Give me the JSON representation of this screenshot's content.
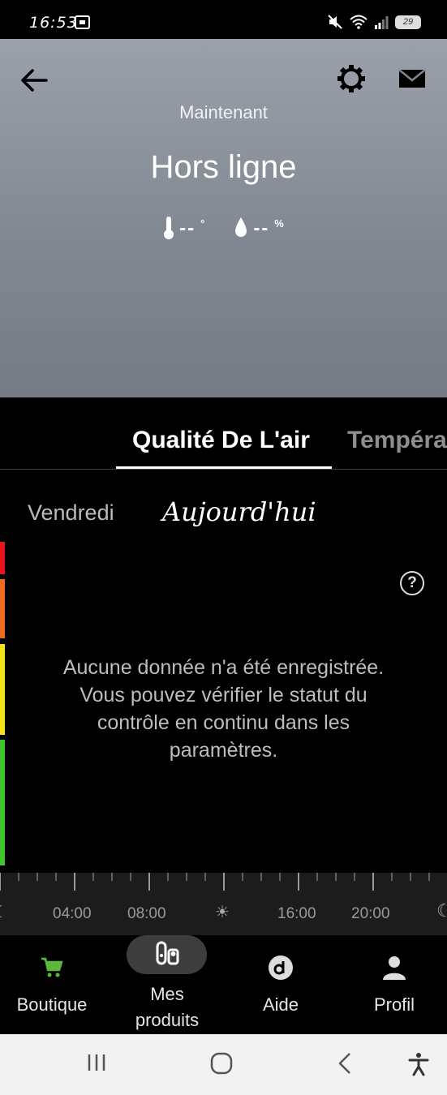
{
  "status_bar": {
    "time": "16:53",
    "battery": "29"
  },
  "hero": {
    "subtitle": "Maintenant",
    "title": "Hors ligne",
    "temperature": {
      "value": "--",
      "unit": "°"
    },
    "humidity": {
      "value": "--",
      "unit": "%"
    }
  },
  "tabs": [
    {
      "label": "Qualité De L'air",
      "active": true
    },
    {
      "label": "Tempéra",
      "active": false
    }
  ],
  "days": {
    "previous": "Vendredi",
    "current": "Aujourd'hui"
  },
  "scale_colors": [
    "#e8141b",
    "#ef6a1f",
    "#f3e41a",
    "#3fc62c"
  ],
  "help_symbol": "?",
  "empty_message": "Aucune donnée n'a été enregistrée. Vous pouvez vérifier le statut du contrôle en continu dans les paramètres.",
  "timeline": {
    "labels": [
      "04:00",
      "08:00",
      "16:00",
      "20:00"
    ]
  },
  "bottom_nav": [
    {
      "label": "Boutique",
      "icon": "cart-icon",
      "accent": "#5cb83c"
    },
    {
      "label": "Mes produits",
      "icon": "products-icon",
      "active": true
    },
    {
      "label": "Aide",
      "icon": "help-d-icon"
    },
    {
      "label": "Profil",
      "icon": "person-icon"
    }
  ]
}
